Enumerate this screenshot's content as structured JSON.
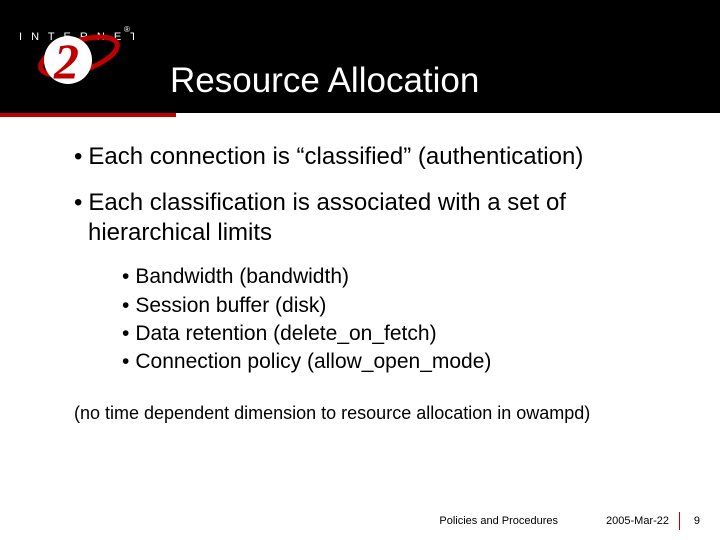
{
  "header": {
    "title": "Resource Allocation",
    "logo_text_top": "I N T E R N E T",
    "logo_mark": "®"
  },
  "bullets": [
    {
      "text": "Each connection is “classified” (authentication)"
    },
    {
      "text": "Each classification is associated with a set of hierarchical limits"
    }
  ],
  "sub_bullets": [
    "Bandwidth (bandwidth)",
    "Session buffer (disk)",
    "Data retention (delete_on_fetch)",
    "Connection policy (allow_open_mode)"
  ],
  "note": "(no time dependent dimension to resource allocation in owampd)",
  "footer": {
    "label": "Policies and Procedures",
    "date": "2005-Mar-22",
    "page": "9"
  },
  "colors": {
    "accent": "#c00000",
    "bg_header": "#000000"
  }
}
